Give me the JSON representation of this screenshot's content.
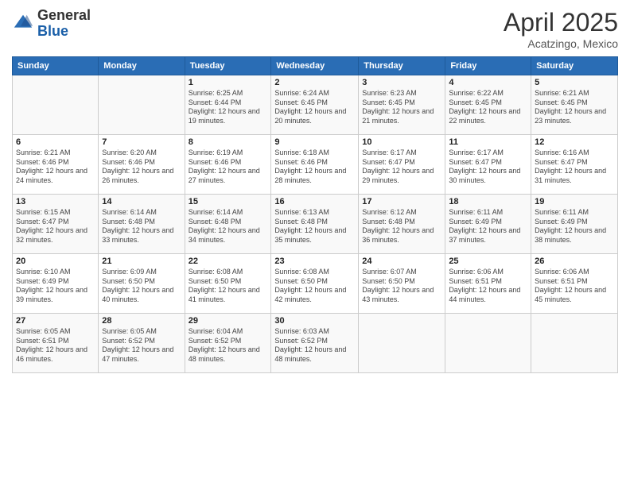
{
  "header": {
    "logo_general": "General",
    "logo_blue": "Blue",
    "title": "April 2025",
    "location": "Acatzingo, Mexico"
  },
  "weekdays": [
    "Sunday",
    "Monday",
    "Tuesday",
    "Wednesday",
    "Thursday",
    "Friday",
    "Saturday"
  ],
  "weeks": [
    [
      {
        "day": "",
        "info": ""
      },
      {
        "day": "",
        "info": ""
      },
      {
        "day": "1",
        "info": "Sunrise: 6:25 AM\nSunset: 6:44 PM\nDaylight: 12 hours and 19 minutes."
      },
      {
        "day": "2",
        "info": "Sunrise: 6:24 AM\nSunset: 6:45 PM\nDaylight: 12 hours and 20 minutes."
      },
      {
        "day": "3",
        "info": "Sunrise: 6:23 AM\nSunset: 6:45 PM\nDaylight: 12 hours and 21 minutes."
      },
      {
        "day": "4",
        "info": "Sunrise: 6:22 AM\nSunset: 6:45 PM\nDaylight: 12 hours and 22 minutes."
      },
      {
        "day": "5",
        "info": "Sunrise: 6:21 AM\nSunset: 6:45 PM\nDaylight: 12 hours and 23 minutes."
      }
    ],
    [
      {
        "day": "6",
        "info": "Sunrise: 6:21 AM\nSunset: 6:46 PM\nDaylight: 12 hours and 24 minutes."
      },
      {
        "day": "7",
        "info": "Sunrise: 6:20 AM\nSunset: 6:46 PM\nDaylight: 12 hours and 26 minutes."
      },
      {
        "day": "8",
        "info": "Sunrise: 6:19 AM\nSunset: 6:46 PM\nDaylight: 12 hours and 27 minutes."
      },
      {
        "day": "9",
        "info": "Sunrise: 6:18 AM\nSunset: 6:46 PM\nDaylight: 12 hours and 28 minutes."
      },
      {
        "day": "10",
        "info": "Sunrise: 6:17 AM\nSunset: 6:47 PM\nDaylight: 12 hours and 29 minutes."
      },
      {
        "day": "11",
        "info": "Sunrise: 6:17 AM\nSunset: 6:47 PM\nDaylight: 12 hours and 30 minutes."
      },
      {
        "day": "12",
        "info": "Sunrise: 6:16 AM\nSunset: 6:47 PM\nDaylight: 12 hours and 31 minutes."
      }
    ],
    [
      {
        "day": "13",
        "info": "Sunrise: 6:15 AM\nSunset: 6:47 PM\nDaylight: 12 hours and 32 minutes."
      },
      {
        "day": "14",
        "info": "Sunrise: 6:14 AM\nSunset: 6:48 PM\nDaylight: 12 hours and 33 minutes."
      },
      {
        "day": "15",
        "info": "Sunrise: 6:14 AM\nSunset: 6:48 PM\nDaylight: 12 hours and 34 minutes."
      },
      {
        "day": "16",
        "info": "Sunrise: 6:13 AM\nSunset: 6:48 PM\nDaylight: 12 hours and 35 minutes."
      },
      {
        "day": "17",
        "info": "Sunrise: 6:12 AM\nSunset: 6:48 PM\nDaylight: 12 hours and 36 minutes."
      },
      {
        "day": "18",
        "info": "Sunrise: 6:11 AM\nSunset: 6:49 PM\nDaylight: 12 hours and 37 minutes."
      },
      {
        "day": "19",
        "info": "Sunrise: 6:11 AM\nSunset: 6:49 PM\nDaylight: 12 hours and 38 minutes."
      }
    ],
    [
      {
        "day": "20",
        "info": "Sunrise: 6:10 AM\nSunset: 6:49 PM\nDaylight: 12 hours and 39 minutes."
      },
      {
        "day": "21",
        "info": "Sunrise: 6:09 AM\nSunset: 6:50 PM\nDaylight: 12 hours and 40 minutes."
      },
      {
        "day": "22",
        "info": "Sunrise: 6:08 AM\nSunset: 6:50 PM\nDaylight: 12 hours and 41 minutes."
      },
      {
        "day": "23",
        "info": "Sunrise: 6:08 AM\nSunset: 6:50 PM\nDaylight: 12 hours and 42 minutes."
      },
      {
        "day": "24",
        "info": "Sunrise: 6:07 AM\nSunset: 6:50 PM\nDaylight: 12 hours and 43 minutes."
      },
      {
        "day": "25",
        "info": "Sunrise: 6:06 AM\nSunset: 6:51 PM\nDaylight: 12 hours and 44 minutes."
      },
      {
        "day": "26",
        "info": "Sunrise: 6:06 AM\nSunset: 6:51 PM\nDaylight: 12 hours and 45 minutes."
      }
    ],
    [
      {
        "day": "27",
        "info": "Sunrise: 6:05 AM\nSunset: 6:51 PM\nDaylight: 12 hours and 46 minutes."
      },
      {
        "day": "28",
        "info": "Sunrise: 6:05 AM\nSunset: 6:52 PM\nDaylight: 12 hours and 47 minutes."
      },
      {
        "day": "29",
        "info": "Sunrise: 6:04 AM\nSunset: 6:52 PM\nDaylight: 12 hours and 48 minutes."
      },
      {
        "day": "30",
        "info": "Sunrise: 6:03 AM\nSunset: 6:52 PM\nDaylight: 12 hours and 48 minutes."
      },
      {
        "day": "",
        "info": ""
      },
      {
        "day": "",
        "info": ""
      },
      {
        "day": "",
        "info": ""
      }
    ]
  ]
}
